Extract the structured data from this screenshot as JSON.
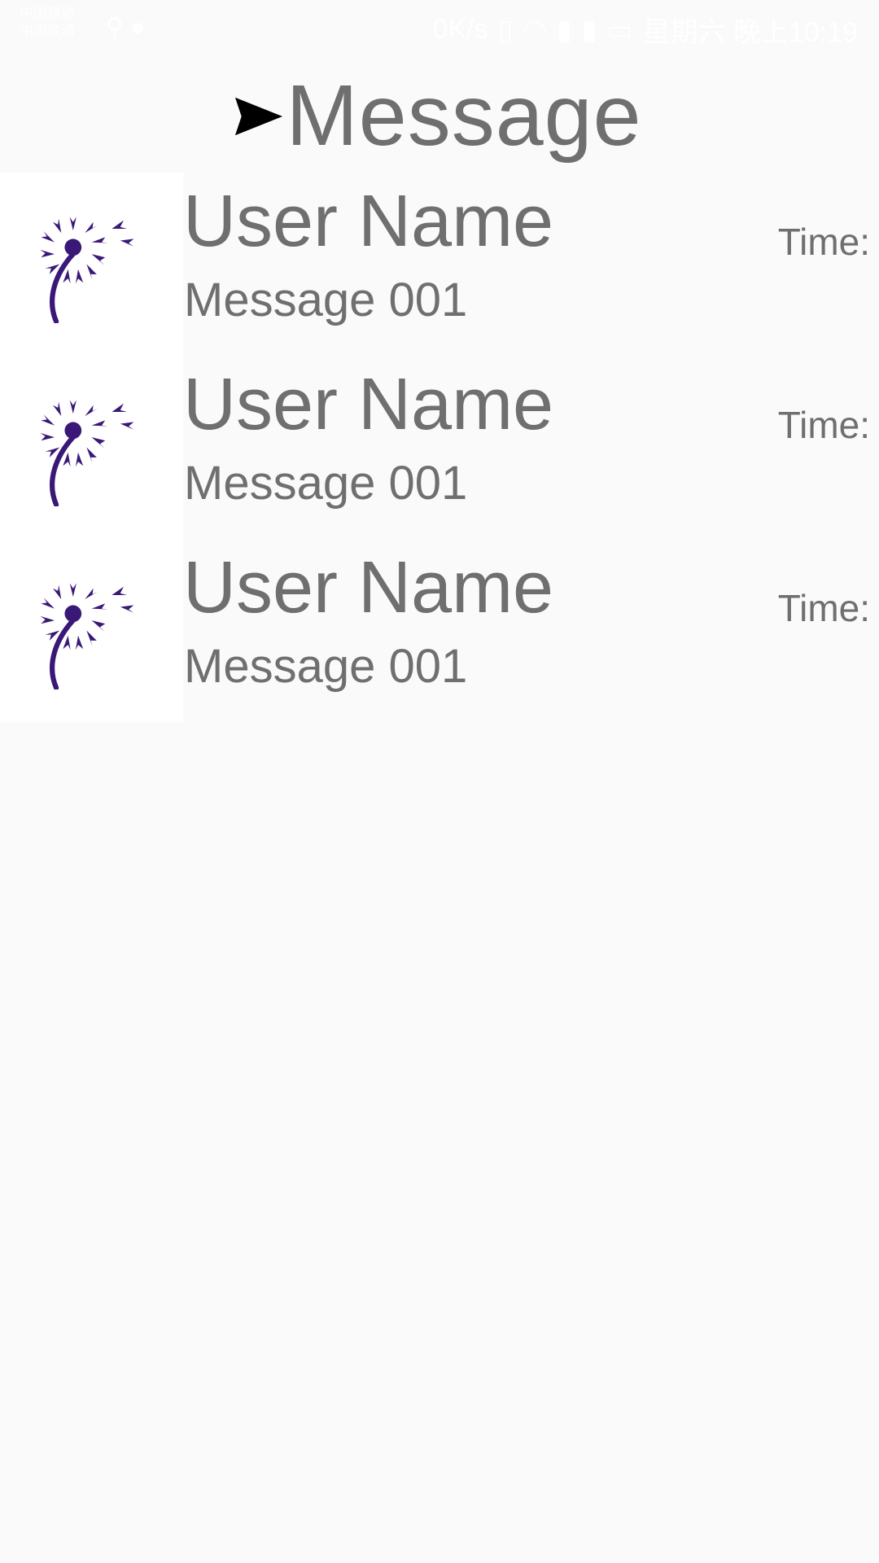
{
  "status_bar": {
    "left_line1": "中国移动",
    "left_line2": "中国联通",
    "network_speed": "0K/s",
    "time_text": "星期六 晚上10:19",
    "icons": [
      "usb-icon",
      "wechat-icon",
      "vibrate-icon",
      "wifi-icon",
      "signal-icon",
      "signal-icon-2",
      "battery-icon"
    ]
  },
  "header": {
    "title": "Message",
    "icon": "send-icon"
  },
  "messages": [
    {
      "user_name": "User Name",
      "message": "Message 001",
      "time_label": "Time:",
      "avatar_icon": "dandelion-icon"
    },
    {
      "user_name": "User Name",
      "message": "Message 001",
      "time_label": "Time:",
      "avatar_icon": "dandelion-icon"
    },
    {
      "user_name": "User Name",
      "message": "Message 001",
      "time_label": "Time:",
      "avatar_icon": "dandelion-icon"
    }
  ],
  "colors": {
    "background": "#fafafa",
    "text": "#6f6f6f",
    "avatar_bg": "#ffffff",
    "avatar_icon": "#3a1878"
  }
}
